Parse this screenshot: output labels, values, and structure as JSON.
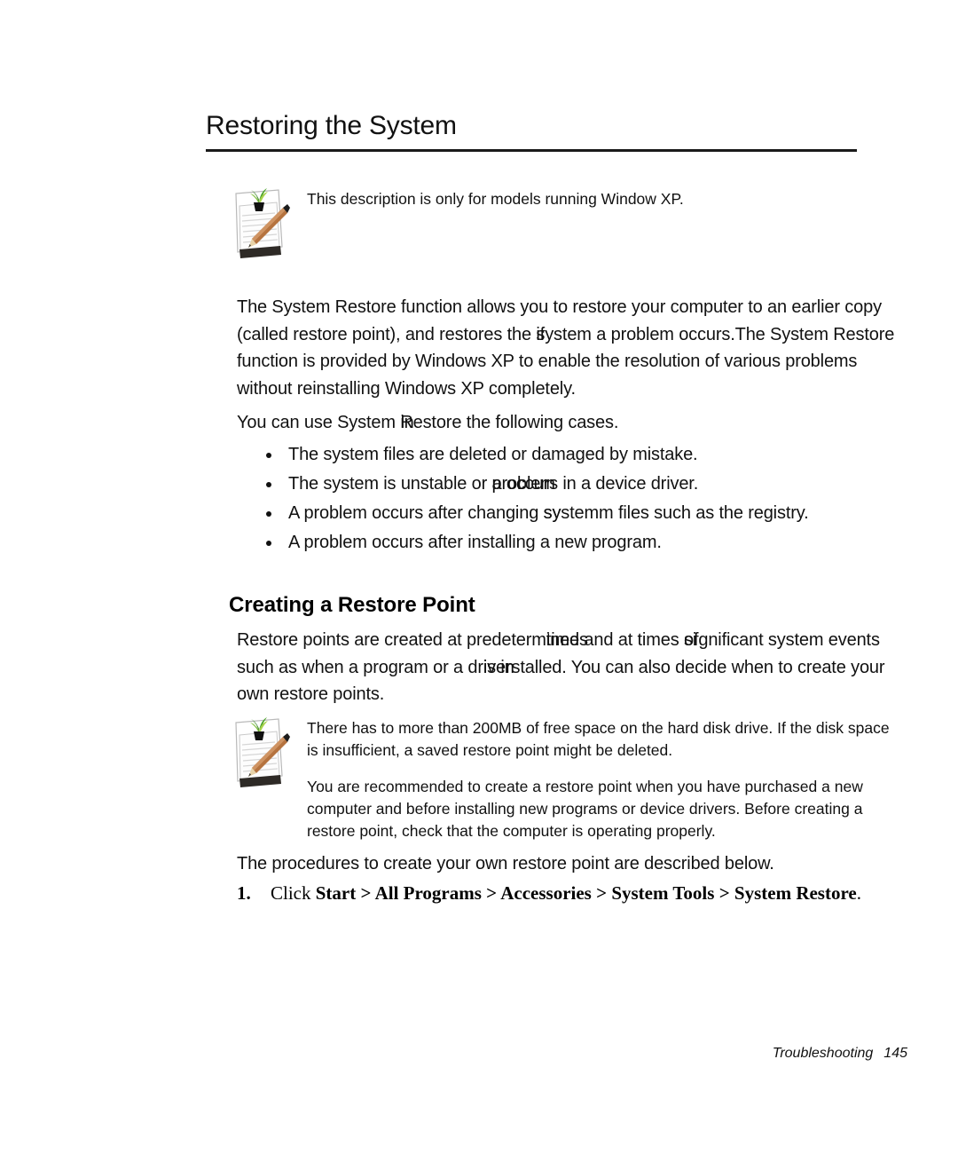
{
  "page": {
    "title": "Restoring the System",
    "background_color": "#ffffff",
    "text_color": "#111111"
  },
  "note_1": {
    "icon_name": "notepad-pencil-icon",
    "text": "This description is only for models running Window XP."
  },
  "intro": {
    "line1": "The System Restore function allows you to restore your computer to an earlier copy",
    "line2_a": "(called restore point), and restores the ",
    "line2_overlap_under": "system",
    "line2_overlap_over": "if",
    "line2_b": " a problem occurs.The System Restore",
    "line3": "function is provided by Windows XP to enable the resolution of various problems",
    "line4": "without reinstalling Windows XP completely."
  },
  "usecase": {
    "prefix": "You can use System ",
    "overlap_under": "Restore",
    "overlap_over": "in",
    "suffix": " the following cases."
  },
  "bullets": [
    {
      "prefix": "The system files are deleted or damaged by mistake.",
      "overlap_under": "",
      "overlap_over": "",
      "suffix": ""
    },
    {
      "prefix": "The system is unstable or ",
      "overlap_under": "a",
      "overlap_over": "problem",
      "suffix": " occurs in a device driver."
    },
    {
      "prefix": "A problem occurs after changing ",
      "overlap_under": "system",
      "overlap_over": "sy",
      "suffix": "m files such as the registry."
    },
    {
      "prefix": "A problem occurs after installing a new program.",
      "overlap_under": "",
      "overlap_over": "",
      "suffix": ""
    }
  ],
  "sub_heading": "Creating a Restore Point",
  "restore_para": {
    "line1_a": "Restore points are created at predeterm",
    "line1_overlap_under": "ined",
    "line1_overlap_over": "times",
    "line1_b": " and at times ",
    "line1_overlap2_under": "of",
    "line1_overlap2_over": "si",
    "line1_c": "gnificant system",
    "line2_a": "events such as when a program or a dr",
    "line2_overlap_under": "iver",
    "line2_overlap_over": "is in",
    "line2_b": "stalled. You can also decide when to",
    "line3": "create your own restore points."
  },
  "note_2": {
    "icon_name": "notepad-pencil-icon",
    "paragraph_1": "There has to more than 200MB of free space on the hard disk drive. If the disk space is insufficient, a saved restore point might be deleted.",
    "paragraph_2": "You are recommended to create a restore point when you have purchased a new computer and before installing new programs or device drivers. Before creating a restore point, check that the computer is operating properly."
  },
  "procedure": {
    "intro": "The procedures to create your own restore point are described below.",
    "step_number": "1.",
    "step_prefix": "Click ",
    "step_path_1": "Start",
    "sep_1": " > ",
    "step_path_2": "All Programs",
    "sep_2": " > ",
    "step_path_3": "Accessories",
    "sep_3": " > ",
    "step_path_4": "System Tools",
    "sep_4": " > ",
    "step_path_5": "System Restore",
    "step_suffix": "."
  },
  "footer": {
    "section": "Troubleshooting",
    "page_number": "145"
  }
}
